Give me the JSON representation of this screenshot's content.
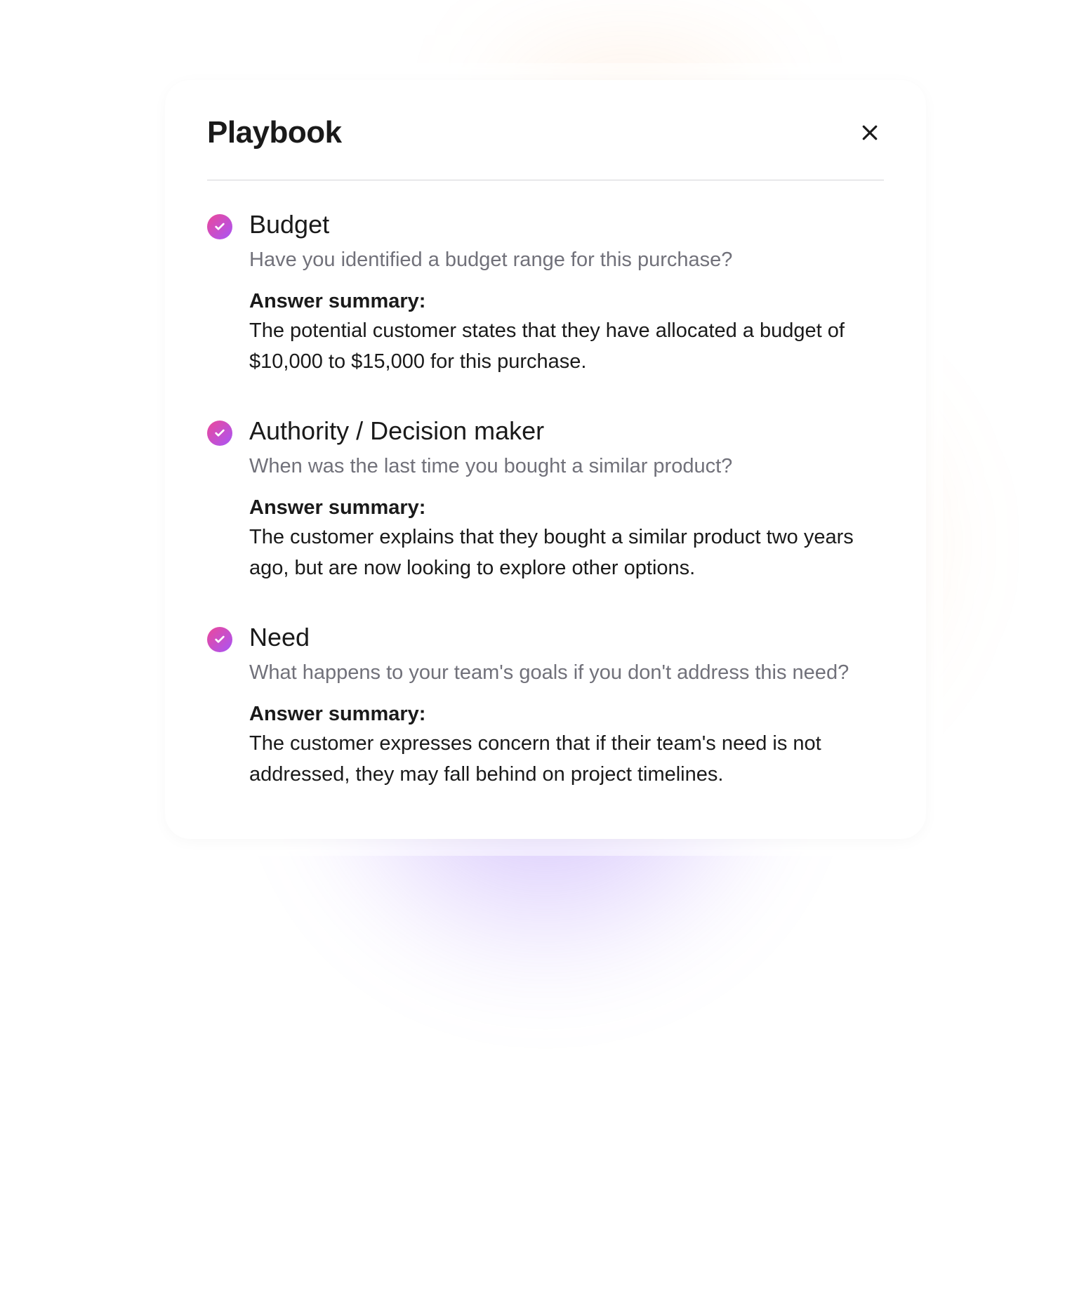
{
  "header": {
    "title": "Playbook"
  },
  "answer_summary_label": "Answer summary:",
  "items": [
    {
      "title": "Budget",
      "question": "Have you identified a budget range for this purchase?",
      "answer": "The potential customer states that they have allocated a budget of $10,000 to $15,000 for this purchase."
    },
    {
      "title": "Authority / Decision maker",
      "question": "When was the last time you bought a similar product?",
      "answer": "The customer explains that they bought a similar product two years ago, but are now looking to explore other options."
    },
    {
      "title": "Need",
      "question": "What happens to your team's goals if you don't address this need?",
      "answer": "The customer expresses concern that if their team's need is not addressed, they may fall behind on project timelines."
    }
  ]
}
